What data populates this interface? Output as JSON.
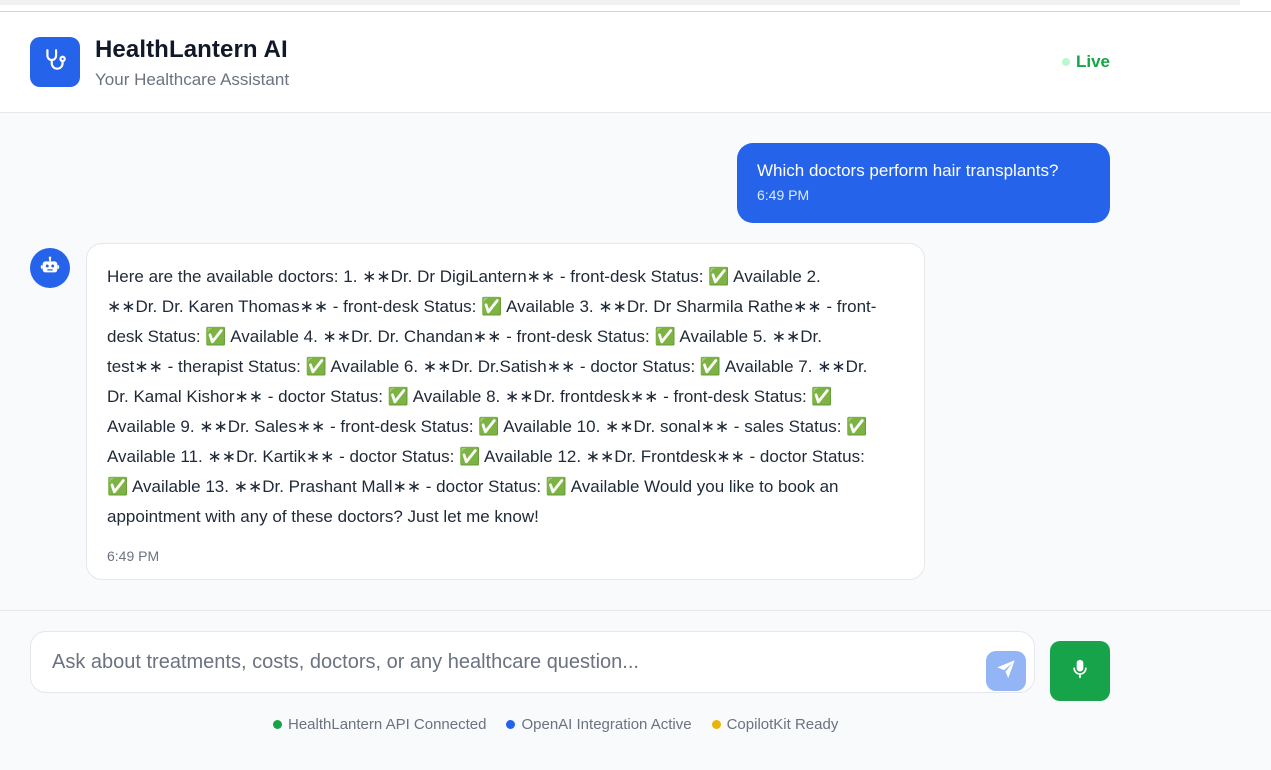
{
  "header": {
    "title": "HealthLantern AI",
    "subtitle": "Your Healthcare Assistant",
    "status_label": "Live",
    "logo_icon": "stethoscope-icon"
  },
  "messages": [
    {
      "role": "user",
      "text": "Which doctors perform hair transplants?",
      "time": "6:49 PM"
    },
    {
      "role": "assistant",
      "avatar_icon": "robot-icon",
      "text": "Here are the available doctors: 1. ∗∗Dr. Dr DigiLantern∗∗ - front-desk Status: ✅ Available 2.\n∗∗Dr. Dr. Karen Thomas∗∗ - front-desk Status: ✅ Available 3. ∗∗Dr. Dr Sharmila Rathe∗∗ - front-\ndesk Status: ✅ Available 4. ∗∗Dr. Dr. Chandan∗∗ - front-desk Status: ✅ Available 5. ∗∗Dr.\ntest∗∗ - therapist Status: ✅ Available 6. ∗∗Dr. Dr.Satish∗∗ - doctor Status: ✅ Available 7. ∗∗Dr.\nDr. Kamal Kishor∗∗ - doctor Status: ✅ Available 8. ∗∗Dr. frontdesk∗∗ - front-desk Status: ✅\nAvailable 9. ∗∗Dr. Sales∗∗ - front-desk Status: ✅ Available 10. ∗∗Dr. sonal∗∗ - sales Status: ✅\nAvailable 11. ∗∗Dr. Kartik∗∗ - doctor Status: ✅ Available 12. ∗∗Dr. Frontdesk∗∗ - doctor Status:\n✅ Available 13. ∗∗Dr. Prashant Mall∗∗ - doctor Status: ✅ Available Would you like to book an\nappointment with any of these doctors? Just let me know!",
      "time": "6:49 PM"
    }
  ],
  "composer": {
    "placeholder": "Ask about treatments, costs, doctors, or any healthcare question...",
    "value": "",
    "send_icon": "send-icon",
    "mic_icon": "microphone-icon"
  },
  "status_bar": [
    {
      "label": "HealthLantern API Connected",
      "color": "#16a34a"
    },
    {
      "label": "OpenAI Integration Active",
      "color": "#2563eb"
    },
    {
      "label": "CopilotKit Ready",
      "color": "#eab308"
    }
  ],
  "colors": {
    "primary": "#2563eb",
    "success": "#16a34a",
    "send_disabled": "#93b4f5"
  }
}
